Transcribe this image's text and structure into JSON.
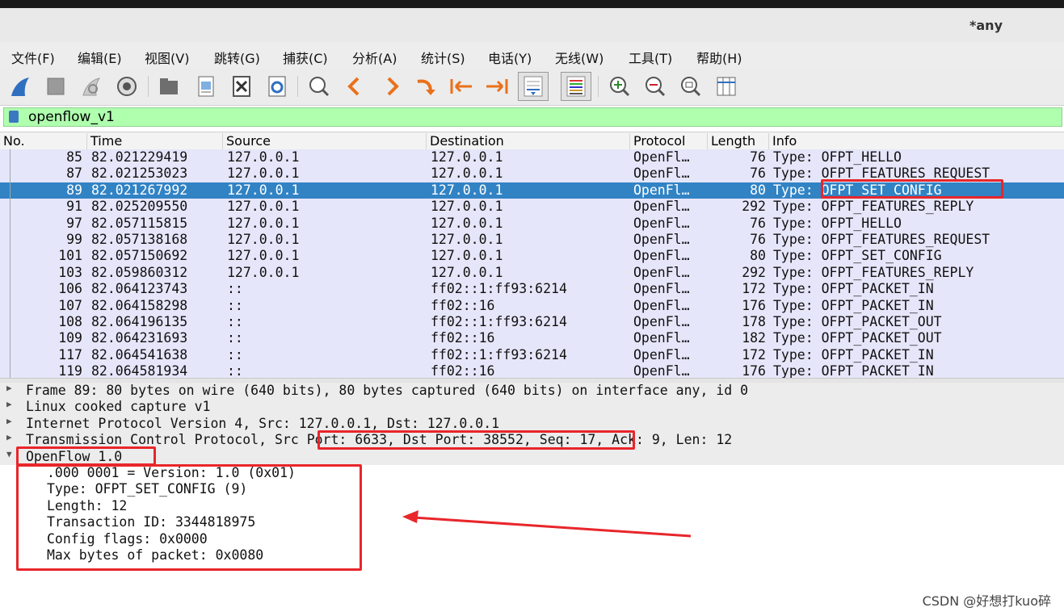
{
  "window": {
    "title": "*any"
  },
  "menu": [
    "文件(F)",
    "编辑(E)",
    "视图(V)",
    "跳转(G)",
    "捕获(C)",
    "分析(A)",
    "统计(S)",
    "电话(Y)",
    "无线(W)",
    "工具(T)",
    "帮助(H)"
  ],
  "toolbar": {
    "icons": [
      "shark-fin-start-icon",
      "stop-square-icon",
      "restart-capture-icon",
      "capture-options-gear-icon",
      "open-folder-icon",
      "save-file-icon",
      "close-file-icon",
      "reload-file-icon",
      "find-packet-icon",
      "go-back-arrow-icon",
      "go-forward-arrow-icon",
      "go-to-packet-icon",
      "first-packet-icon",
      "last-packet-icon",
      "autoscroll-icon",
      "colorize-icon",
      "zoom-in-icon",
      "zoom-out-icon",
      "zoom-reset-icon",
      "resize-columns-icon"
    ]
  },
  "filter": {
    "value": "openflow_v1"
  },
  "packet_list": {
    "columns": [
      "No.",
      "Time",
      "Source",
      "Destination",
      "Protocol",
      "Length",
      "Info"
    ],
    "rows": [
      {
        "no": "85",
        "time": "82.021229419",
        "source": "127.0.0.1",
        "destination": "127.0.0.1",
        "protocol": "OpenFl…",
        "length": "76",
        "info": "Type: OFPT_HELLO"
      },
      {
        "no": "87",
        "time": "82.021253023",
        "source": "127.0.0.1",
        "destination": "127.0.0.1",
        "protocol": "OpenFl…",
        "length": "76",
        "info": "Type: OFPT_FEATURES_REQUEST"
      },
      {
        "no": "89",
        "time": "82.021267992",
        "source": "127.0.0.1",
        "destination": "127.0.0.1",
        "protocol": "OpenFl…",
        "length": "80",
        "info": "Type: OFPT_SET_CONFIG",
        "selected": true
      },
      {
        "no": "91",
        "time": "82.025209550",
        "source": "127.0.0.1",
        "destination": "127.0.0.1",
        "protocol": "OpenFl…",
        "length": "292",
        "info": "Type: OFPT_FEATURES_REPLY"
      },
      {
        "no": "97",
        "time": "82.057115815",
        "source": "127.0.0.1",
        "destination": "127.0.0.1",
        "protocol": "OpenFl…",
        "length": "76",
        "info": "Type: OFPT_HELLO"
      },
      {
        "no": "99",
        "time": "82.057138168",
        "source": "127.0.0.1",
        "destination": "127.0.0.1",
        "protocol": "OpenFl…",
        "length": "76",
        "info": "Type: OFPT_FEATURES_REQUEST"
      },
      {
        "no": "101",
        "time": "82.057150692",
        "source": "127.0.0.1",
        "destination": "127.0.0.1",
        "protocol": "OpenFl…",
        "length": "80",
        "info": "Type: OFPT_SET_CONFIG"
      },
      {
        "no": "103",
        "time": "82.059860312",
        "source": "127.0.0.1",
        "destination": "127.0.0.1",
        "protocol": "OpenFl…",
        "length": "292",
        "info": "Type: OFPT_FEATURES_REPLY"
      },
      {
        "no": "106",
        "time": "82.064123743",
        "source": "::",
        "destination": "ff02::1:ff93:6214",
        "protocol": "OpenFl…",
        "length": "172",
        "info": "Type: OFPT_PACKET_IN"
      },
      {
        "no": "107",
        "time": "82.064158298",
        "source": "::",
        "destination": "ff02::16",
        "protocol": "OpenFl…",
        "length": "176",
        "info": "Type: OFPT_PACKET_IN"
      },
      {
        "no": "108",
        "time": "82.064196135",
        "source": "::",
        "destination": "ff02::1:ff93:6214",
        "protocol": "OpenFl…",
        "length": "178",
        "info": "Type: OFPT_PACKET_OUT"
      },
      {
        "no": "109",
        "time": "82.064231693",
        "source": "::",
        "destination": "ff02::16",
        "protocol": "OpenFl…",
        "length": "182",
        "info": "Type: OFPT_PACKET_OUT"
      },
      {
        "no": "117",
        "time": "82.064541638",
        "source": "::",
        "destination": "ff02::1:ff93:6214",
        "protocol": "OpenFl…",
        "length": "172",
        "info": "Type: OFPT_PACKET_IN"
      },
      {
        "no": "119",
        "time": "82.064581934",
        "source": "::",
        "destination": "ff02::16",
        "protocol": "OpenFl…",
        "length": "176",
        "info": "Type: OFPT_PACKET_IN"
      }
    ]
  },
  "details": {
    "frame": "Frame 89: 80 bytes on wire (640 bits), 80 bytes captured (640 bits) on interface any, id 0",
    "linux": "Linux cooked capture v1",
    "ip": "Internet Protocol Version 4, Src: 127.0.0.1, Dst: 127.0.0.1",
    "tcp_prefix": "Transmission Control Protocol, ",
    "tcp_ports": "Src Port: 6633, Dst Port: 38552",
    "tcp_suffix": ", Seq: 17, Ack: 9, Len: 12",
    "openflow": "OpenFlow 1.0",
    "fields": [
      ".000 0001 = Version: 1.0 (0x01)",
      "Type: OFPT_SET_CONFIG (9)",
      "Length: 12",
      "Transaction ID: 3344818975",
      "Config flags: 0x0000",
      "Max bytes of packet: 0x0080"
    ]
  },
  "watermark": "CSDN @好想打kuo碎",
  "colors": {
    "row_bg": "#e6e6fa",
    "selected_bg": "#3183c4",
    "filter_bg": "#afffaf",
    "highlight": "#e8262b"
  }
}
